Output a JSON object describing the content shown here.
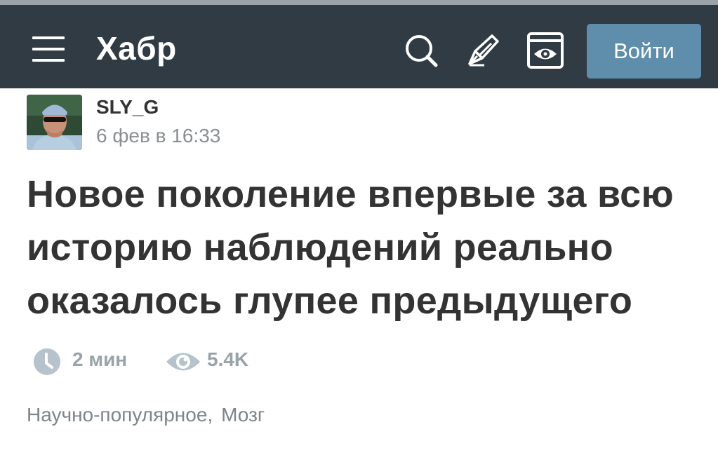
{
  "header": {
    "logo": "Хабр",
    "login_label": "Войти",
    "menu_icon": "hamburger-menu-icon",
    "search_icon": "search-icon",
    "write_icon": "pen-icon",
    "settings_icon": "eye-square-icon",
    "background_color": "#303b44",
    "login_color": "#5e8eac"
  },
  "post": {
    "author": "SLY_G",
    "time": "6 фев в 16:33",
    "title": "Новое поколение впервые за всю историю наблюдений реально оказалось глупее предыдущего",
    "reading_time": "2 мин",
    "views": "5.4K",
    "reading_icon": "clock-icon",
    "views_icon": "eye-icon",
    "hubs": [
      "Научно-популярное",
      "Мозг"
    ],
    "hub_separator": ","
  }
}
